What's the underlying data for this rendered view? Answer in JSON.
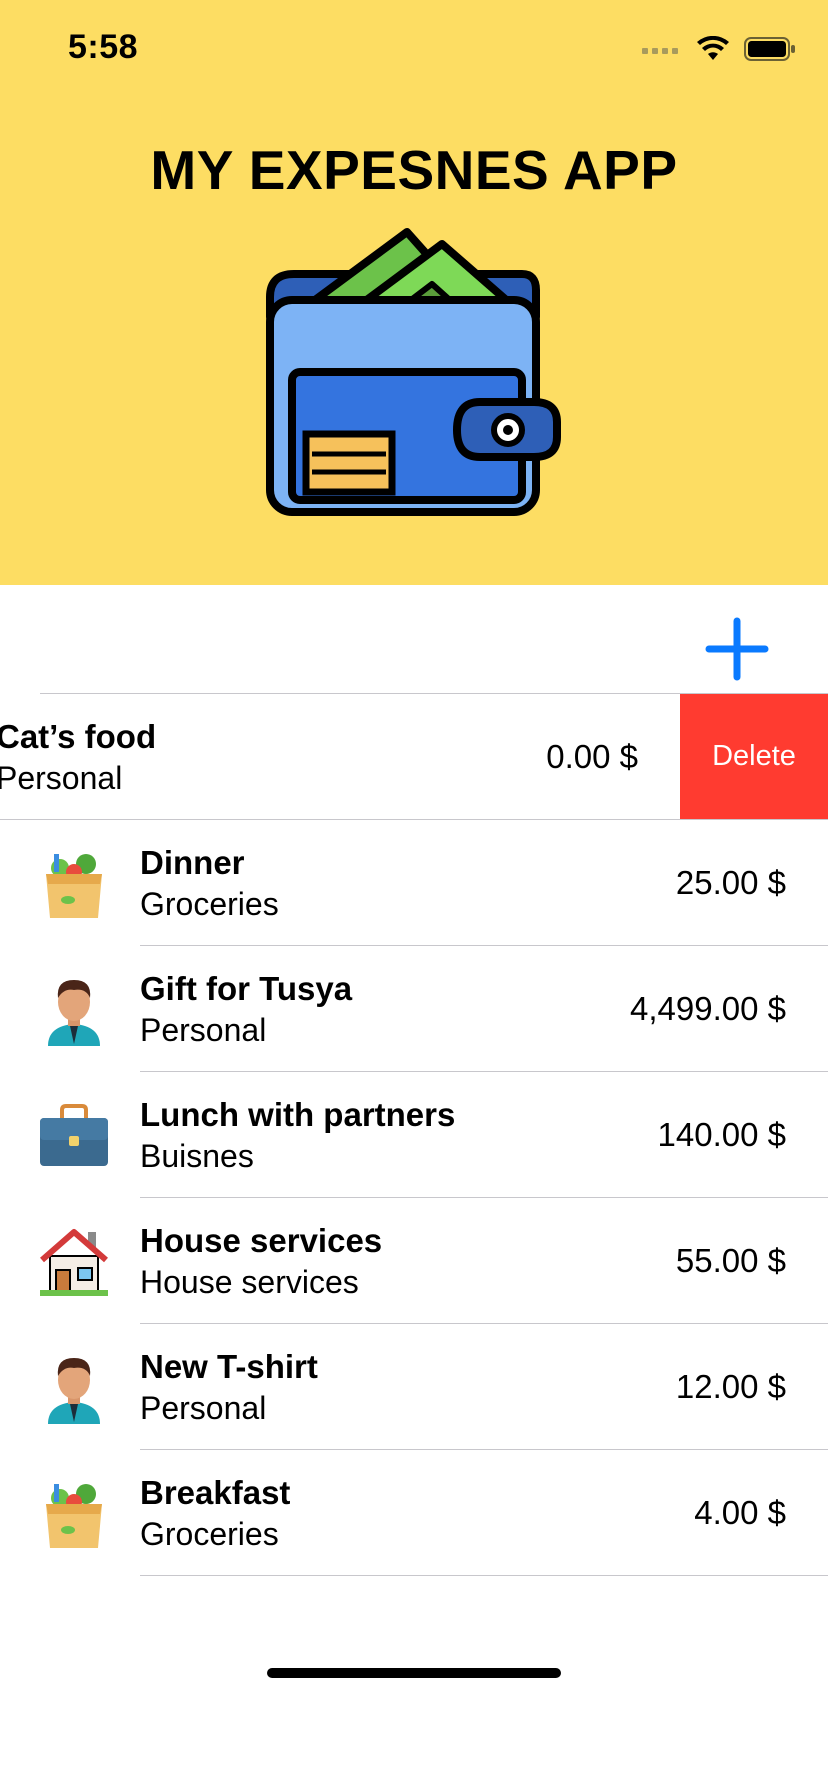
{
  "status_bar": {
    "time": "5:58"
  },
  "header": {
    "title": "MY EXPESNES APP",
    "icon": "wallet-icon",
    "background": "#FDDD63"
  },
  "toolbar": {
    "add_icon": "plus-icon",
    "accent": "#0A7AFF"
  },
  "swiped_row": {
    "name": "Cat’s food",
    "category": "Personal",
    "amount": "0.00 $",
    "delete_label": "Delete",
    "delete_color": "#FF3B30"
  },
  "expenses": [
    {
      "name": "Dinner",
      "category": "Groceries",
      "amount": "25.00 $",
      "icon": "grocery-bag-icon"
    },
    {
      "name": "Gift for Tusya",
      "category": "Personal",
      "amount": "4,499.00 $",
      "icon": "person-avatar-icon"
    },
    {
      "name": "Lunch with partners",
      "category": "Buisnes",
      "amount": "140.00 $",
      "icon": "briefcase-icon"
    },
    {
      "name": "House services",
      "category": "House services",
      "amount": "55.00 $",
      "icon": "house-icon"
    },
    {
      "name": "New T-shirt",
      "category": "Personal",
      "amount": "12.00 $",
      "icon": "person-avatar-icon"
    },
    {
      "name": "Breakfast",
      "category": "Groceries",
      "amount": "4.00 $",
      "icon": "grocery-bag-icon"
    }
  ]
}
